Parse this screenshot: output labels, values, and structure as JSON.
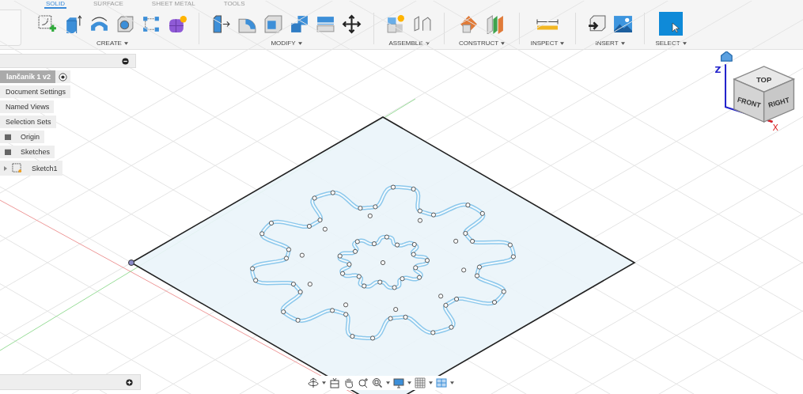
{
  "tabs": [
    {
      "label": "SOLID",
      "selected": true
    },
    {
      "label": "SURFACE",
      "selected": false
    },
    {
      "label": "SHEET METAL",
      "selected": false
    },
    {
      "label": "TOOLS",
      "selected": false
    }
  ],
  "toolbar_groups": [
    {
      "label": "CREATE"
    },
    {
      "label": "MODIFY"
    },
    {
      "label": "ASSEMBLE"
    },
    {
      "label": "CONSTRUCT"
    },
    {
      "label": "INSPECT"
    },
    {
      "label": "INSERT"
    },
    {
      "label": "SELECT"
    }
  ],
  "browser": {
    "root": "lančanik 1 v2",
    "items": [
      {
        "label": "Document Settings",
        "kind": "plain"
      },
      {
        "label": "Named Views",
        "kind": "plain"
      },
      {
        "label": "Selection Sets",
        "kind": "plain"
      },
      {
        "label": "Origin",
        "kind": "folder"
      },
      {
        "label": "Sketches",
        "kind": "folder"
      },
      {
        "label": "Sketch1",
        "kind": "sketch"
      }
    ]
  },
  "viewcube": {
    "faces": [
      "TOP",
      "FRONT",
      "RIGHT"
    ],
    "axes": [
      "Z",
      "X"
    ]
  }
}
